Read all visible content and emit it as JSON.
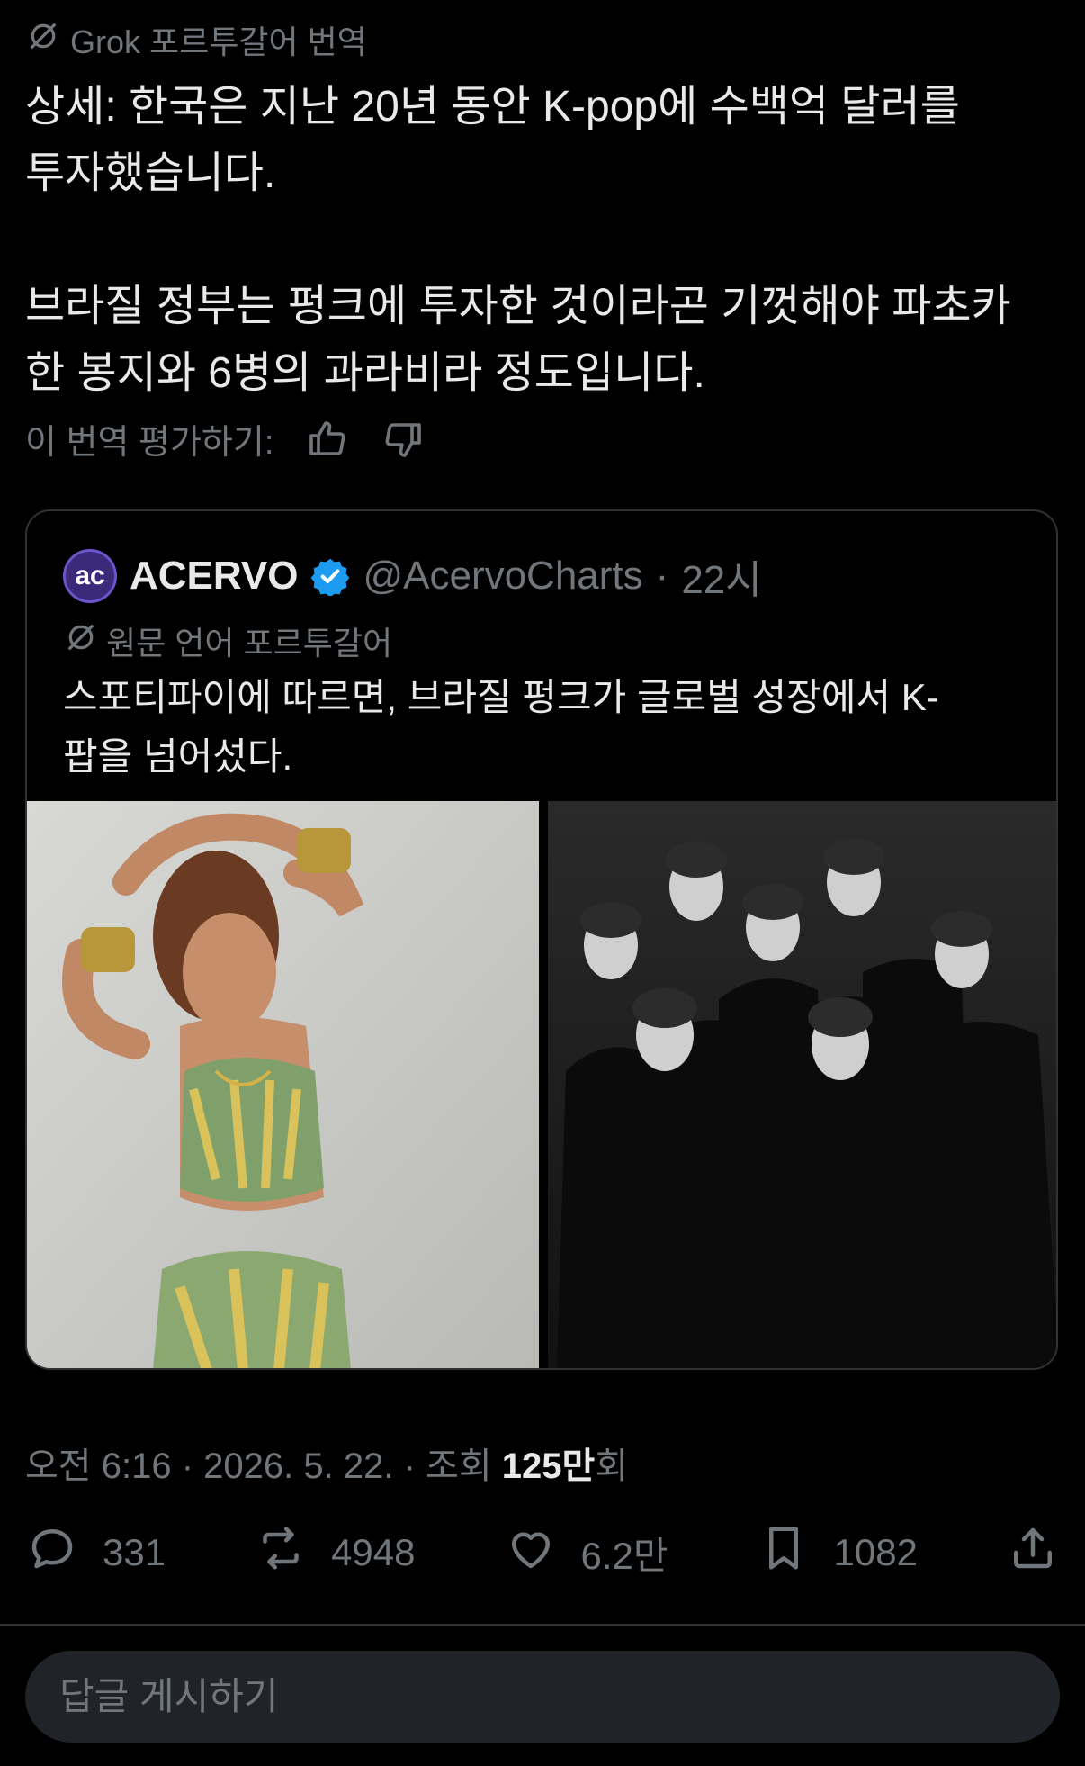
{
  "translation": {
    "label": "Grok 포르투갈어 번역",
    "text": "상세: 한국은 지난 20년 동안 K-pop에 수백억 달러를\n투자했습니다.\n\n브라질 정부는 펑크에 투자한 것이라곤 기껏해야 파초카\n한 봉지와 6병의 과라비라 정도입니다.",
    "rate_label": "이 번역 평가하기:"
  },
  "quote": {
    "avatar_text": "ac",
    "name": "ACERVO",
    "handle": "@AcervoCharts",
    "dot": "·",
    "time": "22시",
    "original_lang_label": "원문 언어 포르투갈어",
    "text": "스포티파이에 따르면, 브라질 펑크가 글로벌 성장에서 K-\n팝을 넘어섰다."
  },
  "meta": {
    "time": "오전 6:16",
    "sep": "·",
    "date": "2026. 5. 22.",
    "views_label": "조회",
    "views_num": "125만",
    "views_suffix": "회"
  },
  "actions": {
    "replies": "331",
    "reposts": "4948",
    "likes": "6.2만",
    "bookmarks": "1082"
  },
  "reply": {
    "placeholder": "답글 게시하기"
  },
  "icons": {
    "grok": "grok-slash-icon",
    "thumbs_up": "thumbs-up-icon",
    "thumbs_down": "thumbs-down-icon",
    "verified": "verified-badge-icon",
    "reply": "reply-bubble-icon",
    "repost": "repost-icon",
    "like": "heart-icon",
    "bookmark": "bookmark-icon",
    "share": "share-icon"
  },
  "colors": {
    "background": "#000000",
    "text": "#e7e9ea",
    "muted": "#71767b",
    "border": "#2f3336",
    "verified": "#1d9bf0"
  }
}
